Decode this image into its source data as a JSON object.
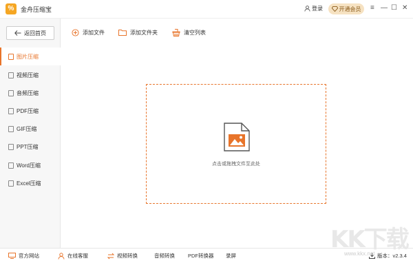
{
  "app": {
    "title": "金舟压缩宝",
    "logo_glyph": "%"
  },
  "titlebar": {
    "login_label": "登录",
    "vip_label": "开通会员",
    "menu_glyph": "≡",
    "minimize_glyph": "—",
    "maximize_glyph": "☐",
    "close_glyph": "✕"
  },
  "sidebar": {
    "back_label": "返回首页",
    "items": [
      {
        "label": "图片压缩",
        "active": true
      },
      {
        "label": "视频压缩"
      },
      {
        "label": "音频压缩"
      },
      {
        "label": "PDF压缩"
      },
      {
        "label": "GIF压缩"
      },
      {
        "label": "PPT压缩"
      },
      {
        "label": "Word压缩"
      },
      {
        "label": "Excel压缩"
      }
    ]
  },
  "toolbar": {
    "add_file_label": "添加文件",
    "add_folder_label": "添加文件夹",
    "clear_list_label": "清空列表"
  },
  "drop_zone": {
    "hint": "点击或拖拽文件至此处"
  },
  "bottombar": {
    "website_label": "官方网站",
    "service_label": "在线客服",
    "video_convert_label": "视频转换",
    "audio_convert_label": "音频转换",
    "pdf_convert_label": "PDF转换器",
    "record_label": "录屏",
    "version_label": "版本：v2.3.4"
  },
  "watermark": {
    "big": "KK下载",
    "small": "www.kkx.net"
  },
  "colors": {
    "accent": "#e8742a",
    "vip_bg": "#f6e2c2",
    "logo": "#f5a623"
  }
}
